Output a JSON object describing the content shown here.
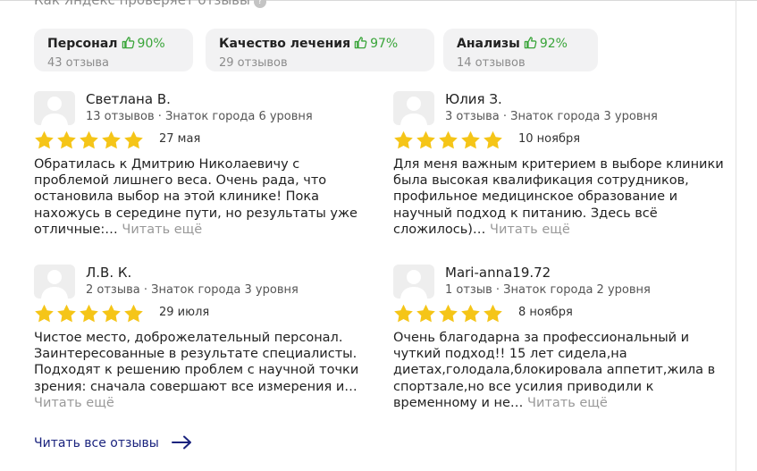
{
  "header": {
    "how_check_label": "Как Яндекс проверяет отзывы",
    "help_icon_glyph": "?"
  },
  "aspects": [
    {
      "name": "Персонал",
      "percent": "90%",
      "count": "43 отзыва"
    },
    {
      "name": "Качество лечения",
      "percent": "97%",
      "count": "29 отзывов"
    },
    {
      "name": "Анализы",
      "percent": "92%",
      "count": "14 отзывов"
    }
  ],
  "reviews": [
    {
      "author": "Светлана В.",
      "meta": "13 отзывов · Знаток города 6 уровня",
      "rating": 5,
      "date": "27 мая",
      "text": "Обратилась к Дмитрию Николаевичу с проблемой лишнего веса. Очень рада, что остановила выбор на этой клинике! Пока нахожусь в середине пути, но результаты уже отличные:…",
      "more": "Читать ещё"
    },
    {
      "author": "Юлия З.",
      "meta": "3 отзыва · Знаток города 3 уровня",
      "rating": 5,
      "date": "10 ноября",
      "text": "Для меня важным критерием в выборе клиники была высокая квалификация сотрудников, профильное медицинское образование и научный подход к питанию. Здесь всё сложилось)…",
      "more": "Читать ещё"
    },
    {
      "author": "Л.В. К.",
      "meta": "2 отзыва · Знаток города 3 уровня",
      "rating": 5,
      "date": "29 июля",
      "text": "Чистое место, доброжелательный персонал. Заинтересованные в результате специалисты. Подходят к решению проблем с научной точки зрения: сначала совершают все измерения и…",
      "more": "Читать ещё"
    },
    {
      "author": "Mari-anna19.72",
      "meta": "1 отзыв · Знаток города 2 уровня",
      "rating": 5,
      "date": "8 ноября",
      "text": "Очень благодарна за профессиональный и чуткий подход!! 15 лет сидела,на диетах,голодала,блокировала аппетит,жила в спортзале,но все усилия приводили к временному и не…",
      "more": "Читать ещё"
    }
  ],
  "footer": {
    "all_reviews_label": "Читать все отзывы"
  },
  "colors": {
    "star": "#f5c518",
    "percent": "#3aa53a",
    "link": "#1a237e",
    "chip_bg": "#f2f2f3"
  },
  "icons": {
    "aspect_icon": "thumbs-up-icon",
    "avatar_icon": "user-placeholder-icon",
    "star_icon": "star-icon",
    "arrow_icon": "arrow-right-icon"
  }
}
